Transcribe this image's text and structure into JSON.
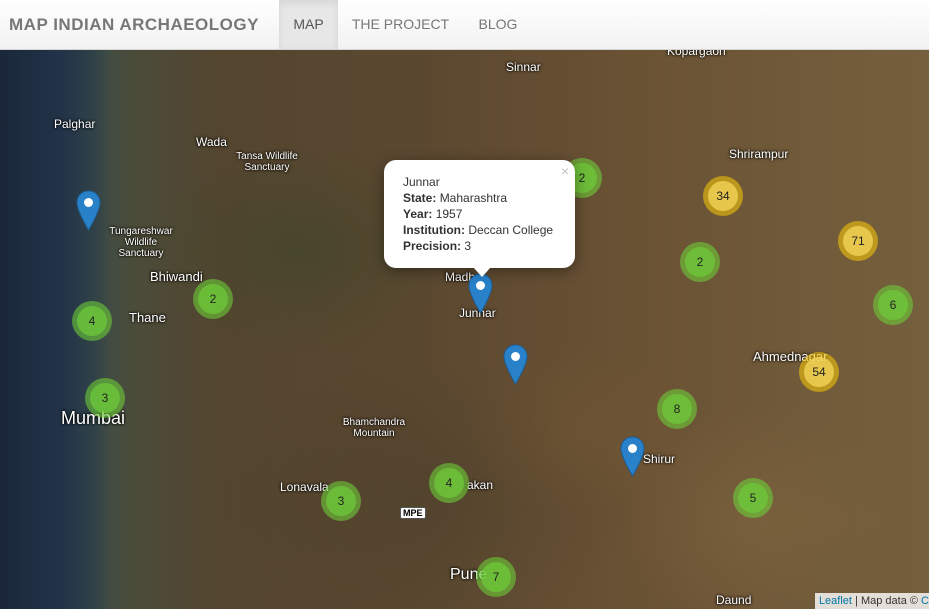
{
  "navbar": {
    "brand": "MAP INDIAN ARCHAEOLOGY",
    "items": [
      {
        "label": "MAP",
        "active": true
      },
      {
        "label": "THE PROJECT",
        "active": false
      },
      {
        "label": "BLOG",
        "active": false
      }
    ]
  },
  "map": {
    "places": {
      "kopargaon": "Kopargaon",
      "sinnar": "Sinnar",
      "palghar": "Palghar",
      "wada": "Wada",
      "tansa": "Tansa Wildlife Sanctuary",
      "shrirampur": "Shrirampur",
      "tungareshwar": "Tungareshwar Wildlife Sanctuary",
      "bhiwandi": "Bhiwandi",
      "thane": "Thane",
      "madh": "Madh",
      "junnar": "Junnar",
      "ahmednagar": "Ahmednagar",
      "mumbai": "Mumbai",
      "bhamchandra": "Bhamchandra Mountain",
      "shirur": "Shirur",
      "chakan": "akan",
      "lonavala": "Lonavala",
      "pune": "Pune",
      "daund": "Daund"
    },
    "road_shield": "MPE",
    "clusters": [
      {
        "count": "2",
        "color": "green"
      },
      {
        "count": "34",
        "color": "yellow"
      },
      {
        "count": "71",
        "color": "yellow"
      },
      {
        "count": "2",
        "color": "green"
      },
      {
        "count": "6",
        "color": "green"
      },
      {
        "count": "2",
        "color": "green"
      },
      {
        "count": "4",
        "color": "green"
      },
      {
        "count": "3",
        "color": "green"
      },
      {
        "count": "54",
        "color": "yellow"
      },
      {
        "count": "8",
        "color": "green"
      },
      {
        "count": "4",
        "color": "green"
      },
      {
        "count": "3",
        "color": "green"
      },
      {
        "count": "5",
        "color": "green"
      },
      {
        "count": "7",
        "color": "green"
      }
    ],
    "marker_color": "#2981ca"
  },
  "popup": {
    "close": "×",
    "title": "Junnar",
    "state_label": "State:",
    "state": "Maharashtra",
    "year_label": "Year:",
    "year": "1957",
    "institution_label": "Institution:",
    "institution": "Deccan College",
    "precision_label": "Precision:",
    "precision": "3"
  },
  "attribution": {
    "leaflet": "Leaflet",
    "text": "| Map data ©",
    "tail": "C"
  }
}
